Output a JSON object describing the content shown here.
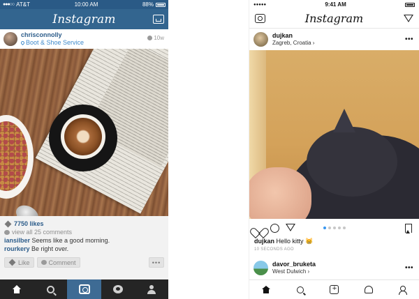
{
  "old_app": {
    "status": {
      "carrier": "AT&T",
      "time": "10:00 AM",
      "battery": "88%"
    },
    "nav": {
      "title": "Instagram"
    },
    "post": {
      "username": "chrisconnolly",
      "location": "Boot & Shoe Service",
      "age": "10w",
      "likes": "7750 likes",
      "view_all": "view all 25 comments",
      "comments": [
        {
          "user": "iansilber",
          "text": "Seems like a good morning."
        },
        {
          "user": "rourkery",
          "text": "Be right over."
        }
      ],
      "like_label": "Like",
      "comment_label": "Comment",
      "more_label": "•••"
    }
  },
  "new_app": {
    "status": {
      "time": "9:41 AM"
    },
    "nav": {
      "title": "Instagram"
    },
    "post": {
      "username": "dujkan",
      "location": "Zagreb, Croatia ›",
      "caption_user": "dujkan",
      "caption_text": "Hello kitty 😸",
      "time_ago": "10 SECONDS AGO",
      "more_label": "•••"
    },
    "next_post": {
      "username": "davor_bruketa",
      "location": "West Dulwich ›",
      "more_label": "•••"
    }
  }
}
